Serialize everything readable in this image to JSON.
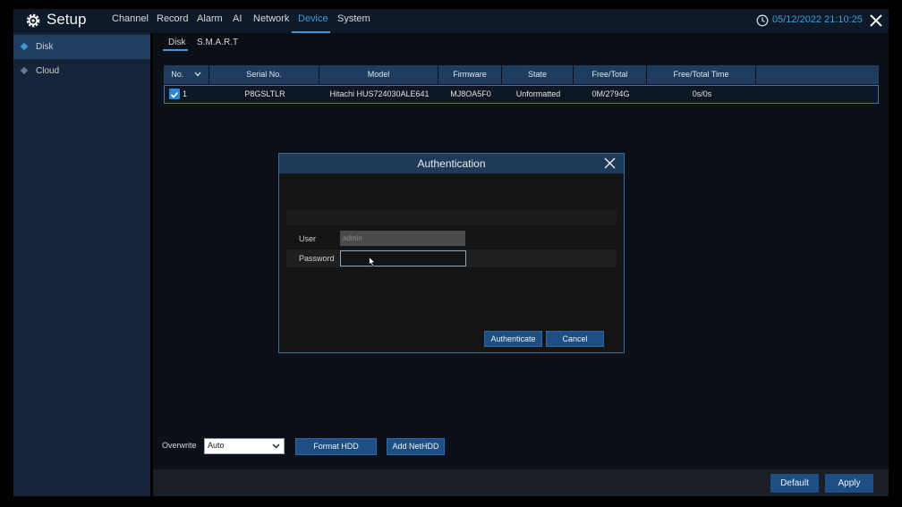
{
  "topbar": {
    "title": "Setup",
    "menu": [
      {
        "label": "Channel"
      },
      {
        "label": "Record"
      },
      {
        "label": "Alarm"
      },
      {
        "label": "AI"
      },
      {
        "label": "Network"
      },
      {
        "label": "Device",
        "active": true
      },
      {
        "label": "System"
      }
    ],
    "datetime": "05/12/2022 21:10:25",
    "icons": {
      "settings": "gear-icon",
      "clock": "clock-icon",
      "close": "close-icon"
    }
  },
  "sidebar": {
    "items": [
      {
        "label": "Disk",
        "active": true
      },
      {
        "label": "Cloud"
      }
    ]
  },
  "tabs": [
    {
      "label": "Disk",
      "active": true
    },
    {
      "label": "S.M.A.R.T"
    }
  ],
  "table": {
    "headers": [
      "No.",
      "Serial No.",
      "Model",
      "Firmware",
      "State",
      "Free/Total",
      "Free/Total Time"
    ],
    "rows": [
      {
        "checked": true,
        "no": "1",
        "serial": "P8GSLTLR",
        "model": "Hitachi HUS724030ALE641",
        "firmware": "MJ8OA5F0",
        "state": "Unformatted",
        "free_total": "0M/2794G",
        "free_total_time": "0s/0s"
      }
    ]
  },
  "controls": {
    "overwrite_label": "Overwrite",
    "overwrite_value": "Auto",
    "format_hdd": "Format HDD",
    "add_nethdd": "Add NetHDD",
    "default": "Default",
    "apply": "Apply"
  },
  "modal": {
    "title": "Authentication",
    "user_label": "User",
    "user_value": "admin",
    "password_label": "Password",
    "password_value": "",
    "authenticate": "Authenticate",
    "cancel": "Cancel"
  },
  "colors": {
    "accent": "#3d9ad8",
    "button": "#1e4f84",
    "header": "#1f3c5e"
  }
}
